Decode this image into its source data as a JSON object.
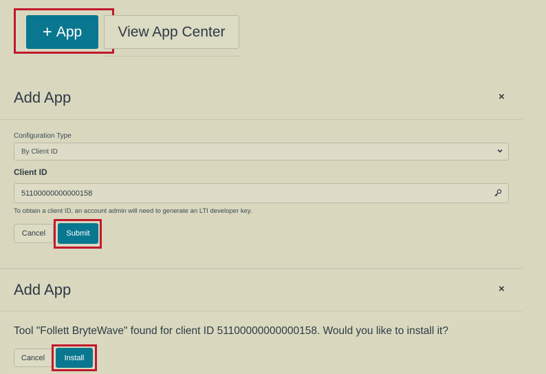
{
  "toolbar": {
    "add_app_label": "App",
    "add_app_icon": "plus-icon",
    "view_app_center_label": "View App Center"
  },
  "modal_config": {
    "title": "Add App",
    "close_label": "×",
    "configuration_type_label": "Configuration Type",
    "configuration_type_value": "By Client ID",
    "client_id_label": "Client ID",
    "client_id_value": "51100000000000158",
    "hint": "To obtain a client ID, an account admin will need to generate an LTI developer key.",
    "cancel_label": "Cancel",
    "submit_label": "Submit"
  },
  "modal_install": {
    "title": "Add App",
    "close_label": "×",
    "message": "Tool \"Follett BryteWave\" found for client ID 51100000000000158. Would you like to install it?",
    "cancel_label": "Cancel",
    "install_label": "Install"
  },
  "colors": {
    "primary": "#0a7790",
    "highlight": "#c0192c",
    "background": "#d9d8bf"
  }
}
